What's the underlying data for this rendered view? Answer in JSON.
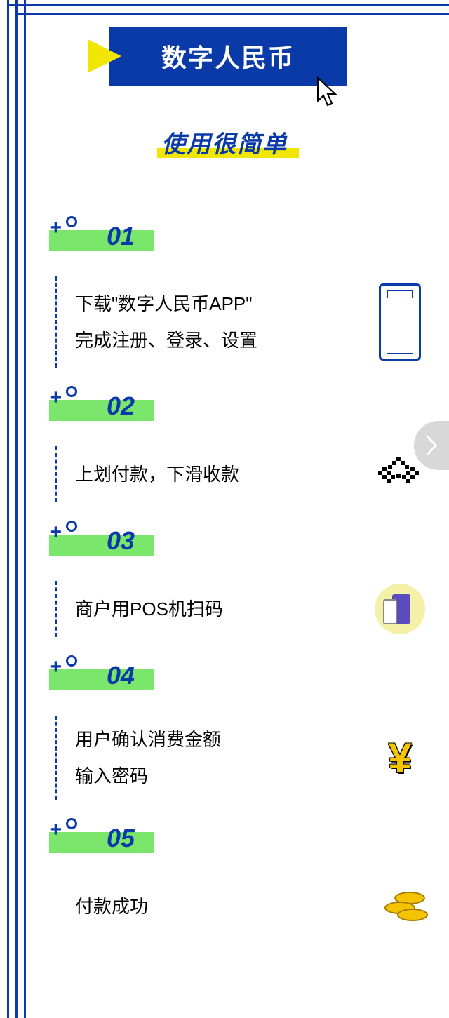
{
  "header": {
    "title": "数字人民币"
  },
  "subtitle": "使用很简单",
  "steps": [
    {
      "num": "01",
      "text_line1": "下载\"数字人民币APP\"",
      "text_line2": "完成注册、登录、设置",
      "icon": "phone-icon"
    },
    {
      "num": "02",
      "text_line1": "上划付款，下滑收款",
      "text_line2": "",
      "icon": "pixel-arrows-icon"
    },
    {
      "num": "03",
      "text_line1": "商户用POS机扫码",
      "text_line2": "",
      "icon": "pos-machine-icon"
    },
    {
      "num": "04",
      "text_line1": "用户确认消费金额",
      "text_line2": "输入密码",
      "icon": "yen-icon"
    },
    {
      "num": "05",
      "text_line1": "付款成功",
      "text_line2": "",
      "icon": "coins-icon"
    }
  ]
}
